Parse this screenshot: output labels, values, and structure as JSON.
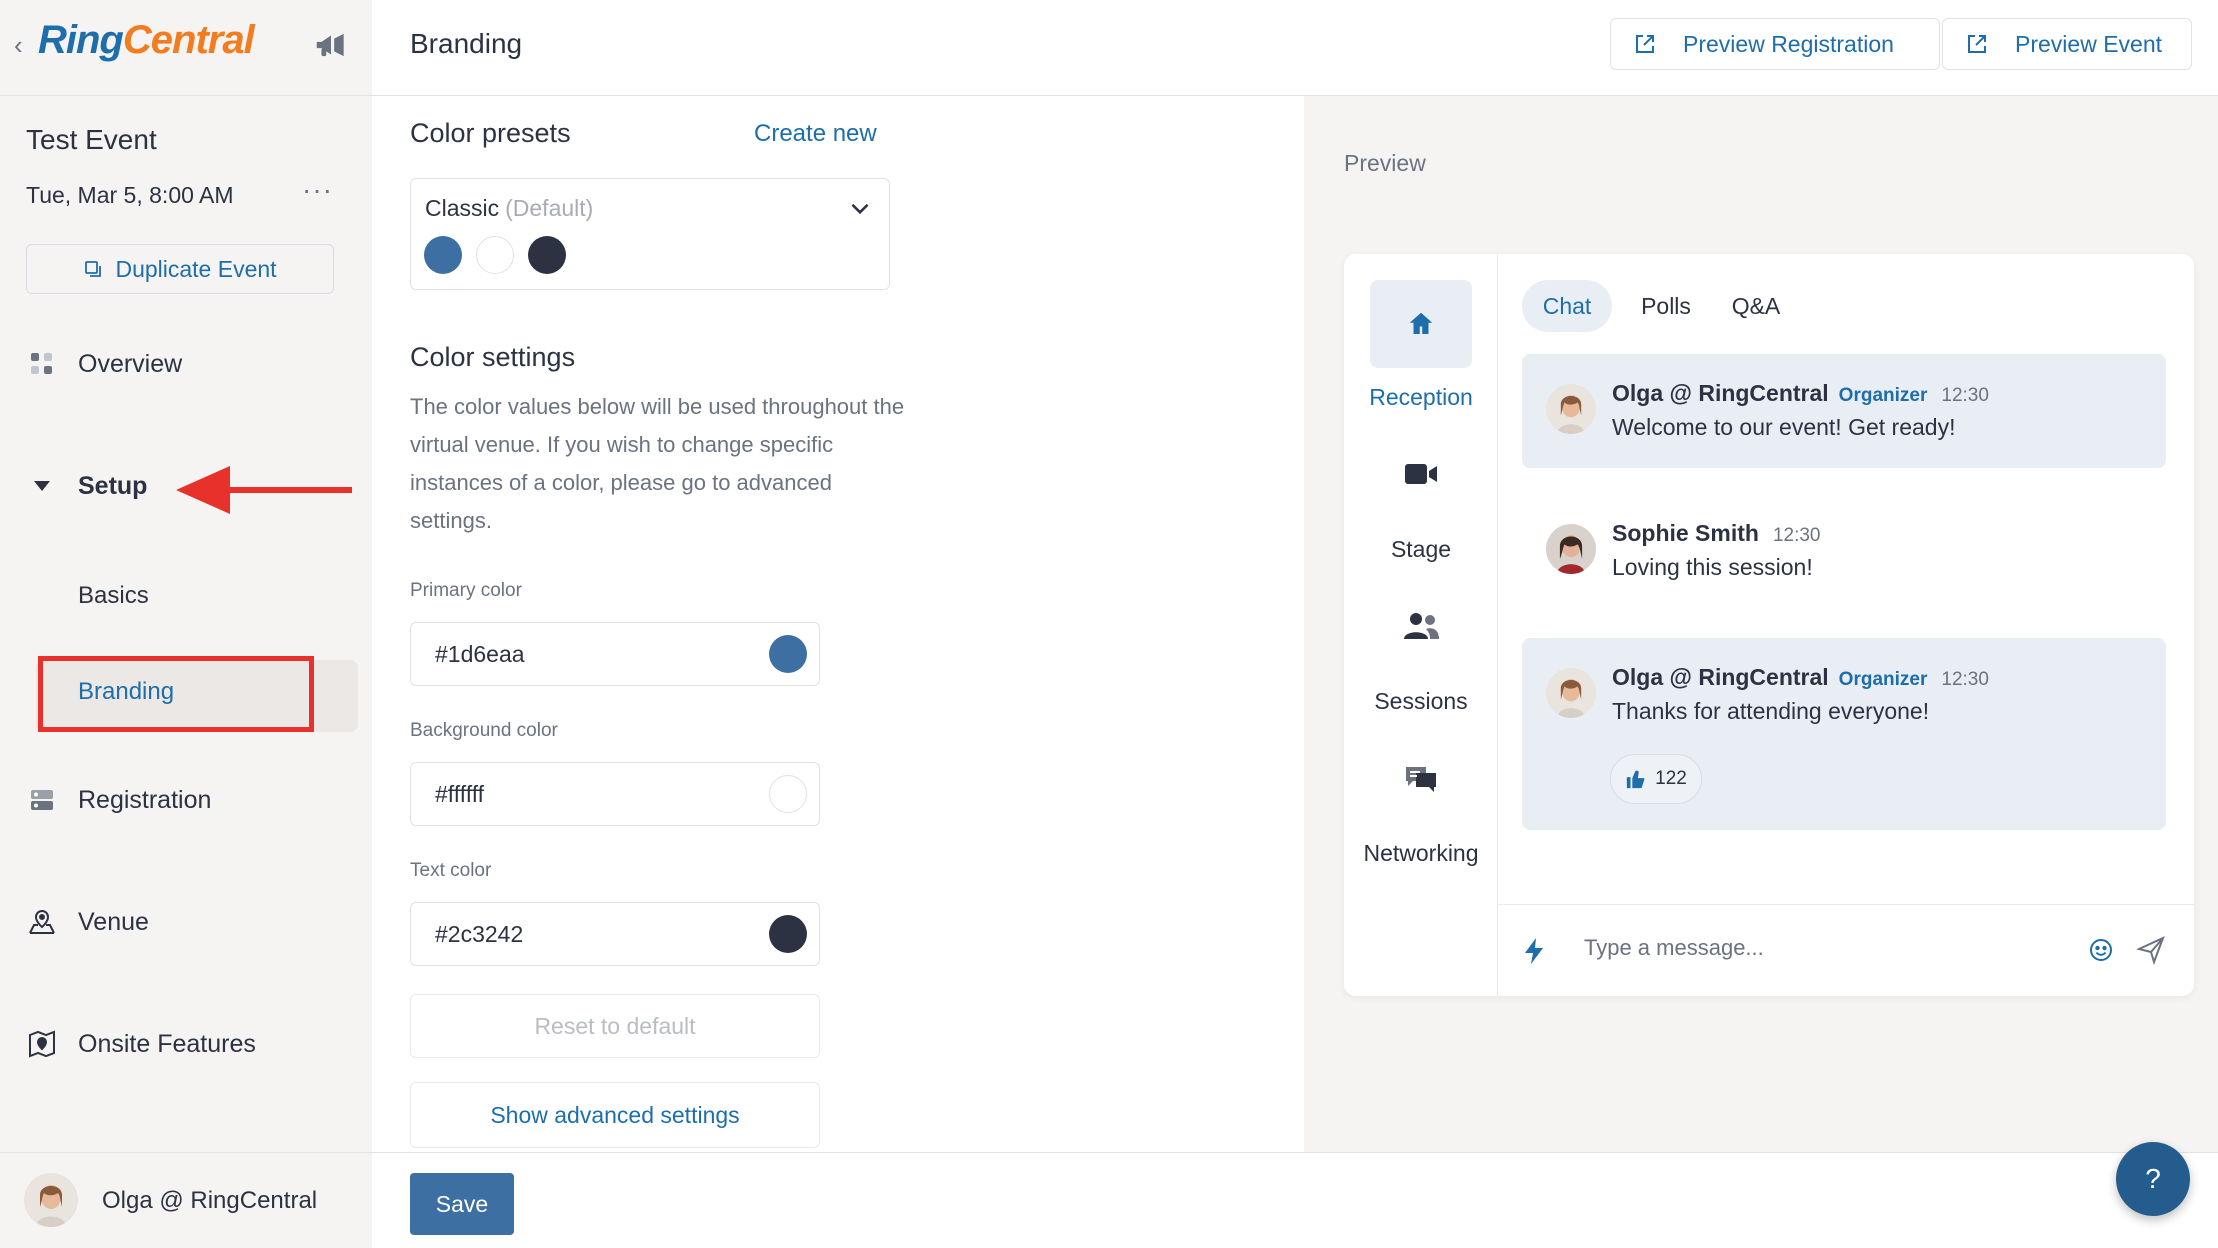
{
  "brand": {
    "logo_part1": "Ring",
    "logo_part2": "Central"
  },
  "event": {
    "title": "Test Event",
    "date": "Tue, Mar 5, 8:00 AM",
    "more": "···",
    "duplicate_label": "Duplicate Event"
  },
  "nav": {
    "overview": "Overview",
    "setup": "Setup",
    "basics": "Basics",
    "branding": "Branding",
    "registration": "Registration",
    "venue": "Venue",
    "onsite": "Onsite Features"
  },
  "user": {
    "name": "Olga @ RingCentral"
  },
  "header": {
    "title": "Branding",
    "preview_registration": "Preview Registration",
    "preview_event": "Preview Event"
  },
  "presets": {
    "title": "Color presets",
    "create_new": "Create new",
    "selected_name": "Classic",
    "selected_tag": "(Default)",
    "swatches": [
      "#3e6fa3",
      "#ffffff",
      "#2c3242"
    ]
  },
  "color_settings": {
    "title": "Color settings",
    "description": "The color values below will be used throughout the virtual venue. If you wish to change specific instances of a color, please go to advanced settings.",
    "primary": {
      "label": "Primary color",
      "value": "#1d6eaa",
      "swatch": "#3e6fa3"
    },
    "background": {
      "label": "Background color",
      "value": "#ffffff",
      "swatch": "#ffffff"
    },
    "text": {
      "label": "Text color",
      "value": "#2c3242",
      "swatch": "#2c3242"
    },
    "reset_label": "Reset to default",
    "advanced_label": "Show advanced settings"
  },
  "footer": {
    "save_label": "Save",
    "help_label": "?"
  },
  "preview": {
    "label": "Preview",
    "venue_nav": [
      "Reception",
      "Stage",
      "Sessions",
      "Networking"
    ],
    "tabs": [
      "Chat",
      "Polls",
      "Q&A"
    ],
    "messages": [
      {
        "name": "Olga @ RingCentral",
        "role": "Organizer",
        "time": "12:30",
        "text": "Welcome to our event! Get ready!"
      },
      {
        "name": "Sophie Smith",
        "role": "",
        "time": "12:30",
        "text": "Loving this session!"
      },
      {
        "name": "Olga @ RingCentral",
        "role": "Organizer",
        "time": "12:30",
        "text": "Thanks for attending everyone!",
        "reaction_count": "122"
      }
    ],
    "compose_placeholder": "Type a message..."
  },
  "colors": {
    "accent": "#1d6eaa",
    "annotation_red": "#e8312a",
    "save_button": "#3e6fa3"
  }
}
